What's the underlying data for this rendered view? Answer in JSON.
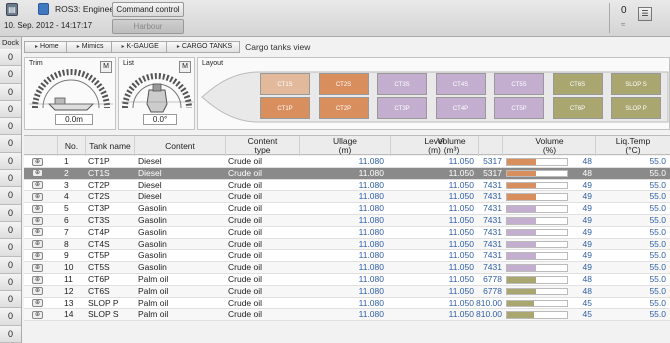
{
  "topbar": {
    "user": "ROS3: Engineer",
    "datetime": "10. Sep. 2012 - 14:17:17",
    "command_control": "Command control",
    "harbour": "Harbour",
    "alarm_count": "0",
    "alarm_down": "≈"
  },
  "dock": {
    "title": "Dock",
    "items": [
      "0",
      "0",
      "0",
      "0",
      "0",
      "0",
      "0",
      "0",
      "0",
      "0",
      "0",
      "0",
      "0",
      "0",
      "0",
      "0",
      "0",
      "0"
    ]
  },
  "breadcrumb": {
    "items": [
      "Home",
      "Mimics",
      "K-GAUGE",
      "CARGO TANKS"
    ],
    "page_title": "Cargo tanks view"
  },
  "trim": {
    "label": "Trim",
    "mode": "M",
    "value": "0.0m"
  },
  "list": {
    "label": "List",
    "mode": "M",
    "value": "0.0°"
  },
  "layout": {
    "label": "Layout",
    "tanks_top": [
      {
        "name": "CT1S",
        "color": "#e2b99a"
      },
      {
        "name": "CT2S",
        "color": "#d98f5d"
      },
      {
        "name": "CT3S",
        "color": "#c4aed0"
      },
      {
        "name": "CT4S",
        "color": "#c4aed0"
      },
      {
        "name": "CT5S",
        "color": "#c4aed0"
      },
      {
        "name": "CT6S",
        "color": "#a9a66f"
      },
      {
        "name": "SLOP S",
        "color": "#a9a66f"
      }
    ],
    "tanks_bottom": [
      {
        "name": "CT1P",
        "color": "#d98f5d"
      },
      {
        "name": "CT2P",
        "color": "#d98f5d"
      },
      {
        "name": "CT3P",
        "color": "#c4aed0"
      },
      {
        "name": "CT4P",
        "color": "#c4aed0"
      },
      {
        "name": "CT5P",
        "color": "#c4aed0"
      },
      {
        "name": "CT6P",
        "color": "#a9a66f"
      },
      {
        "name": "SLOP P",
        "color": "#a9a66f"
      }
    ]
  },
  "table": {
    "headers": {
      "no": "No.",
      "tank": "Tank name",
      "content": "Content",
      "type": "Content\ntype",
      "ullage": "Ullage\n(m)",
      "level": "Level\n(m)",
      "volume": "Volume\n(m³)",
      "volume_pct": "Volume\n(%)",
      "liq_temp": "Liq.Temp\n(°C)"
    },
    "rows": [
      {
        "no": "1",
        "tank": "CT1P",
        "content": "Diesel",
        "type": "Crude oil",
        "ullage": "11.080",
        "level": "11.050",
        "volume": "5317",
        "pct": 48,
        "pct_text": "48",
        "temp": "55.0",
        "color": "#d98f5d"
      },
      {
        "no": "2",
        "tank": "CT1S",
        "content": "Diesel",
        "type": "Crude oil",
        "ullage": "11.080",
        "level": "11.050",
        "volume": "5317",
        "pct": 48,
        "pct_text": "48",
        "temp": "55.0",
        "color": "#d98f5d"
      },
      {
        "no": "3",
        "tank": "CT2P",
        "content": "Diesel",
        "type": "Crude oil",
        "ullage": "11.080",
        "level": "11.050",
        "volume": "7431",
        "pct": 49,
        "pct_text": "49",
        "temp": "55.0",
        "color": "#d98f5d"
      },
      {
        "no": "4",
        "tank": "CT2S",
        "content": "Diesel",
        "type": "Crude oil",
        "ullage": "11.080",
        "level": "11.050",
        "volume": "7431",
        "pct": 49,
        "pct_text": "49",
        "temp": "55.0",
        "color": "#d98f5d"
      },
      {
        "no": "5",
        "tank": "CT3P",
        "content": "Gasolin",
        "type": "Crude oil",
        "ullage": "11.080",
        "level": "11.050",
        "volume": "7431",
        "pct": 49,
        "pct_text": "49",
        "temp": "55.0",
        "color": "#c4aed0"
      },
      {
        "no": "6",
        "tank": "CT3S",
        "content": "Gasolin",
        "type": "Crude oil",
        "ullage": "11.080",
        "level": "11.050",
        "volume": "7431",
        "pct": 49,
        "pct_text": "49",
        "temp": "55.0",
        "color": "#c4aed0"
      },
      {
        "no": "7",
        "tank": "CT4P",
        "content": "Gasolin",
        "type": "Crude oil",
        "ullage": "11.080",
        "level": "11.050",
        "volume": "7431",
        "pct": 49,
        "pct_text": "49",
        "temp": "55.0",
        "color": "#c4aed0"
      },
      {
        "no": "8",
        "tank": "CT4S",
        "content": "Gasolin",
        "type": "Crude oil",
        "ullage": "11.080",
        "level": "11.050",
        "volume": "7431",
        "pct": 49,
        "pct_text": "49",
        "temp": "55.0",
        "color": "#c4aed0"
      },
      {
        "no": "9",
        "tank": "CT5P",
        "content": "Gasolin",
        "type": "Crude oil",
        "ullage": "11.080",
        "level": "11.050",
        "volume": "7431",
        "pct": 49,
        "pct_text": "49",
        "temp": "55.0",
        "color": "#c4aed0"
      },
      {
        "no": "10",
        "tank": "CT5S",
        "content": "Gasolin",
        "type": "Crude oil",
        "ullage": "11.080",
        "level": "11.050",
        "volume": "7431",
        "pct": 49,
        "pct_text": "49",
        "temp": "55.0",
        "color": "#c4aed0"
      },
      {
        "no": "11",
        "tank": "CT6P",
        "content": "Palm oil",
        "type": "Crude oil",
        "ullage": "11.080",
        "level": "11.050",
        "volume": "6778",
        "pct": 48,
        "pct_text": "48",
        "temp": "55.0",
        "color": "#a9a66f"
      },
      {
        "no": "12",
        "tank": "CT6S",
        "content": "Palm oil",
        "type": "Crude oil",
        "ullage": "11.080",
        "level": "11.050",
        "volume": "6778",
        "pct": 48,
        "pct_text": "48",
        "temp": "55.0",
        "color": "#a9a66f"
      },
      {
        "no": "13",
        "tank": "SLOP P",
        "content": "Palm oil",
        "type": "Crude oil",
        "ullage": "11.080",
        "level": "11.050",
        "volume": "810.00",
        "pct": 45,
        "pct_text": "45",
        "temp": "55.0",
        "color": "#a9a66f"
      },
      {
        "no": "14",
        "tank": "SLOP S",
        "content": "Palm oil",
        "type": "Crude oil",
        "ullage": "11.080",
        "level": "11.050",
        "volume": "810.00",
        "pct": 45,
        "pct_text": "45",
        "temp": "55.0",
        "color": "#a9a66f"
      }
    ],
    "selected_row": 1
  }
}
